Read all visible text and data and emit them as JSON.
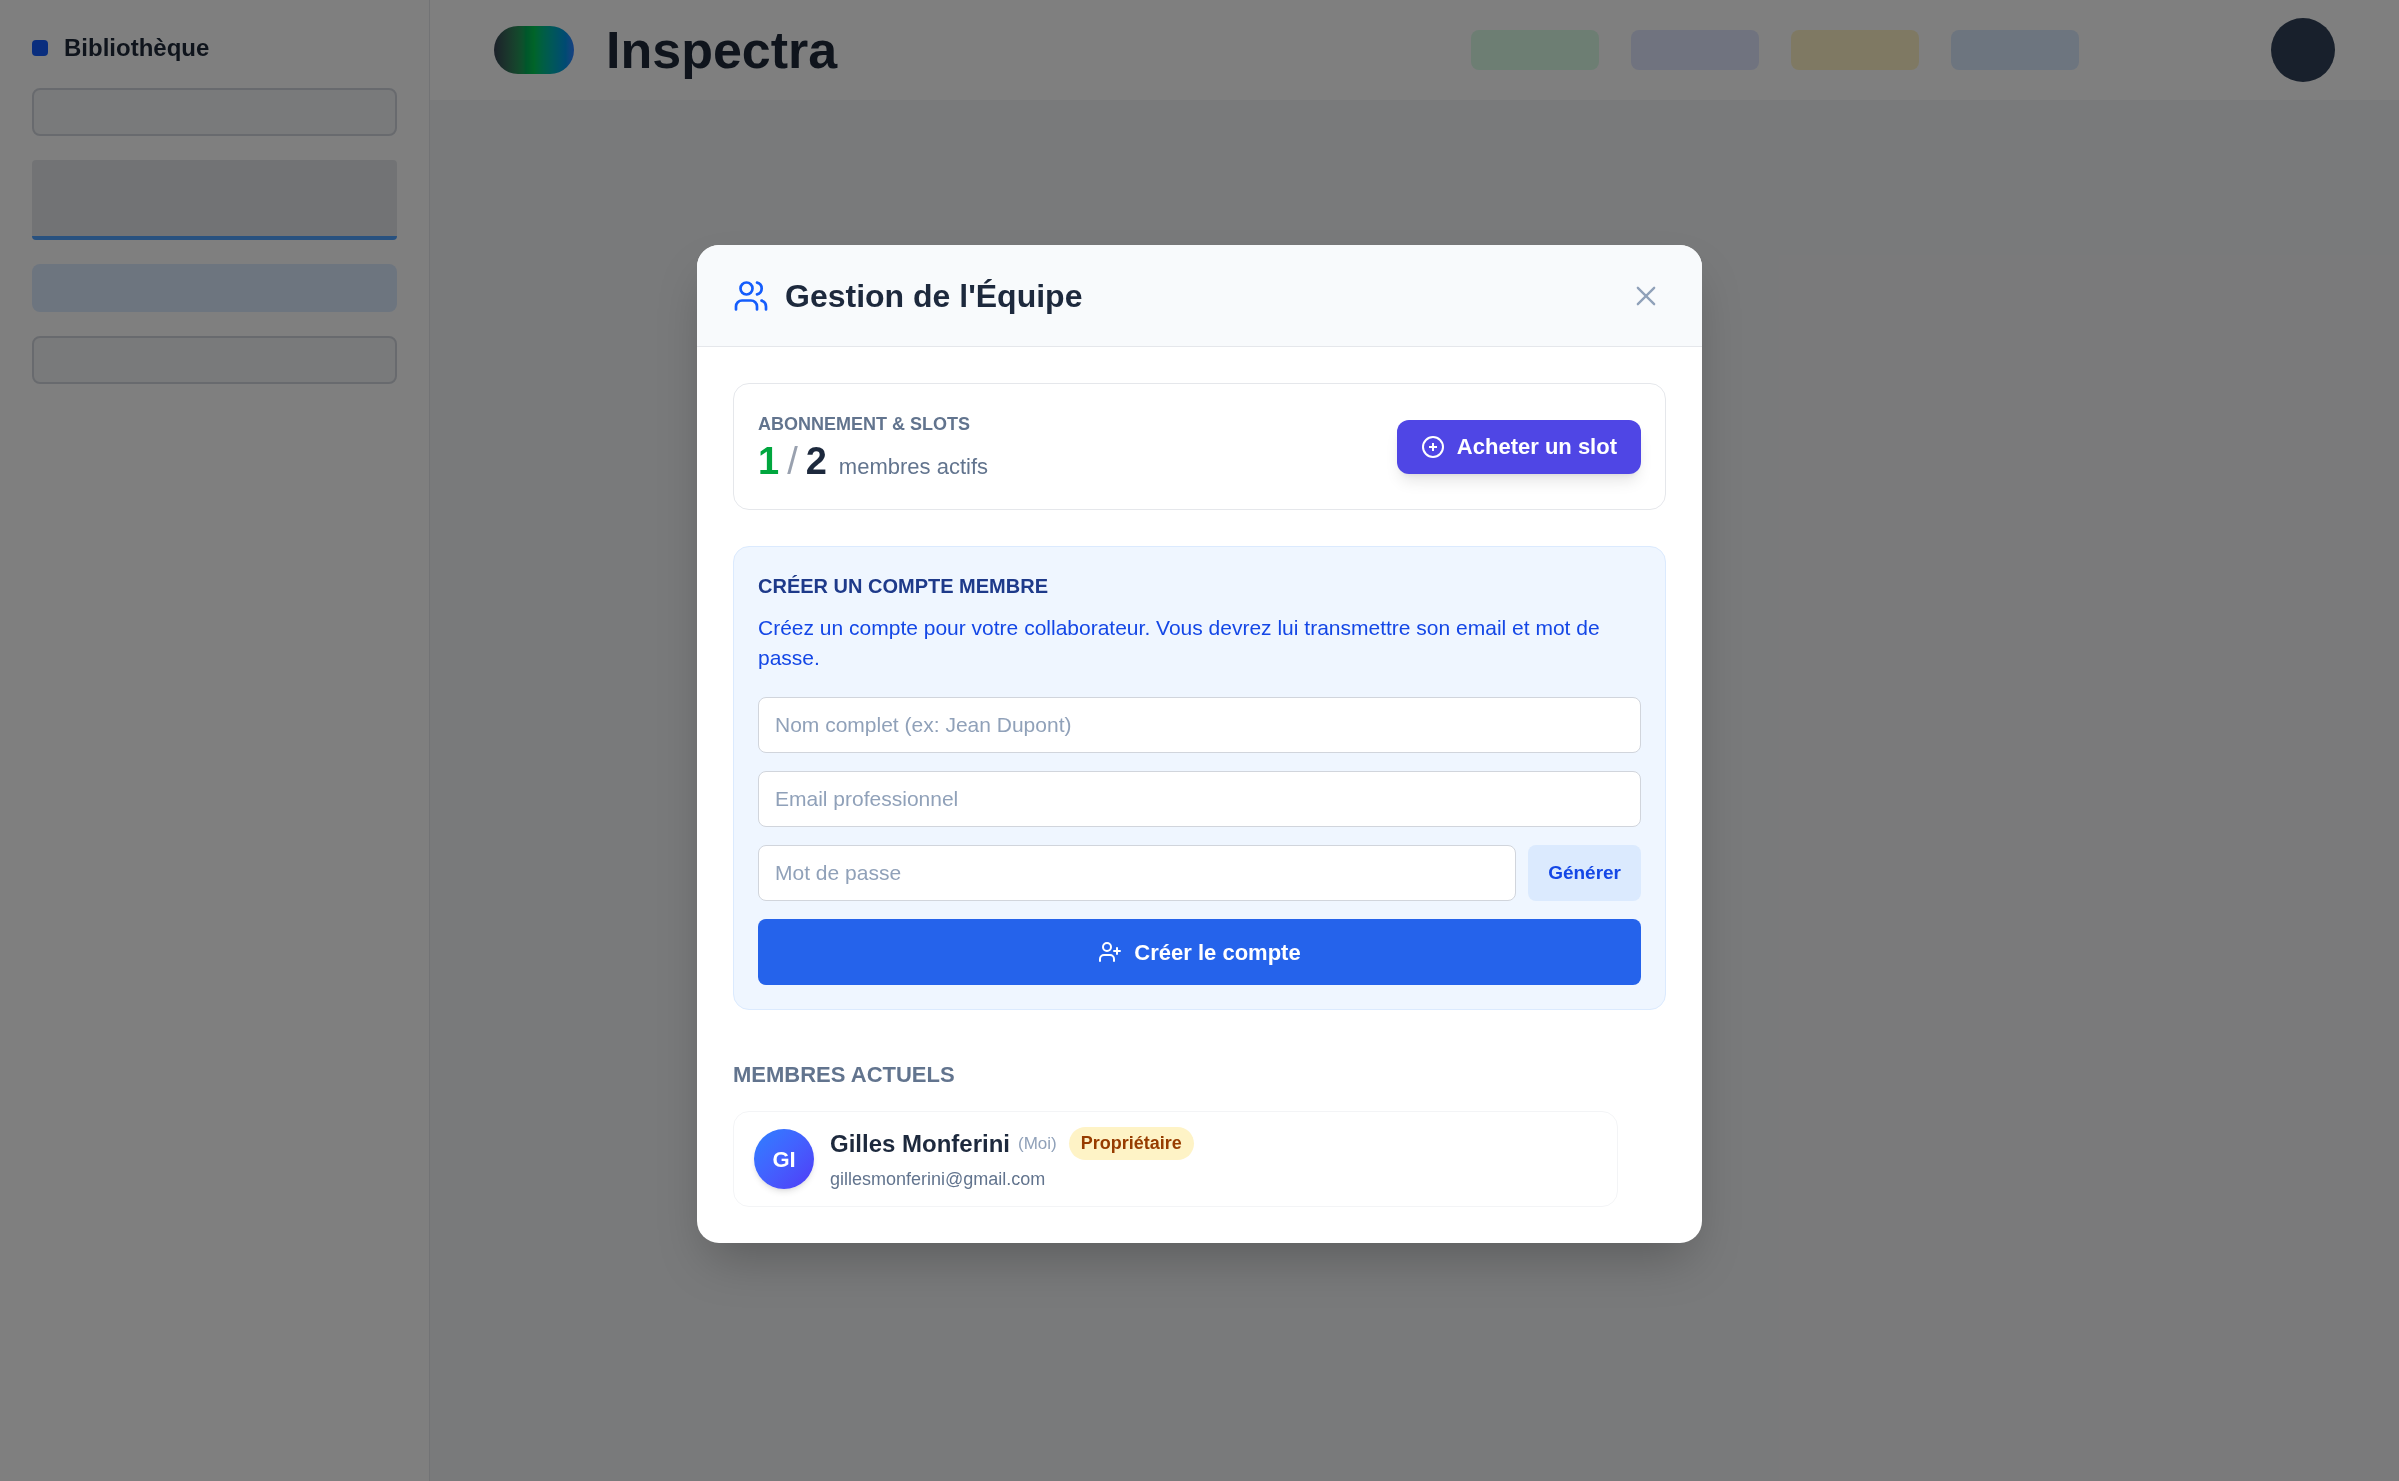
{
  "background": {
    "sidebar_title": "Bibliothèque",
    "brand": "Inspectra"
  },
  "modal": {
    "title": "Gestion de l'Équipe",
    "subscription": {
      "label": "ABONNEMENT & SLOTS",
      "used": "1",
      "separator": "/",
      "total": "2",
      "caption": "membres actifs",
      "button": "Acheter un slot"
    },
    "create": {
      "heading": "CRÉER UN COMPTE MEMBRE",
      "description": "Créez un compte pour votre collaborateur. Vous devrez lui transmettre son email et mot de passe.",
      "fields": [
        {
          "placeholder": "Nom complet (ex: Jean Dupont)"
        },
        {
          "placeholder": "Email professionnel"
        },
        {
          "placeholder": "Mot de passe"
        }
      ],
      "generate_button": "Générer",
      "submit_button": "Créer le compte"
    },
    "members_heading": "MEMBRES ACTUELS",
    "members": [
      {
        "initials": "GI",
        "name": "Gilles Monferini",
        "me": "(Moi)",
        "role": "Propriétaire",
        "email": "gillesmonferini@gmail.com"
      }
    ]
  }
}
